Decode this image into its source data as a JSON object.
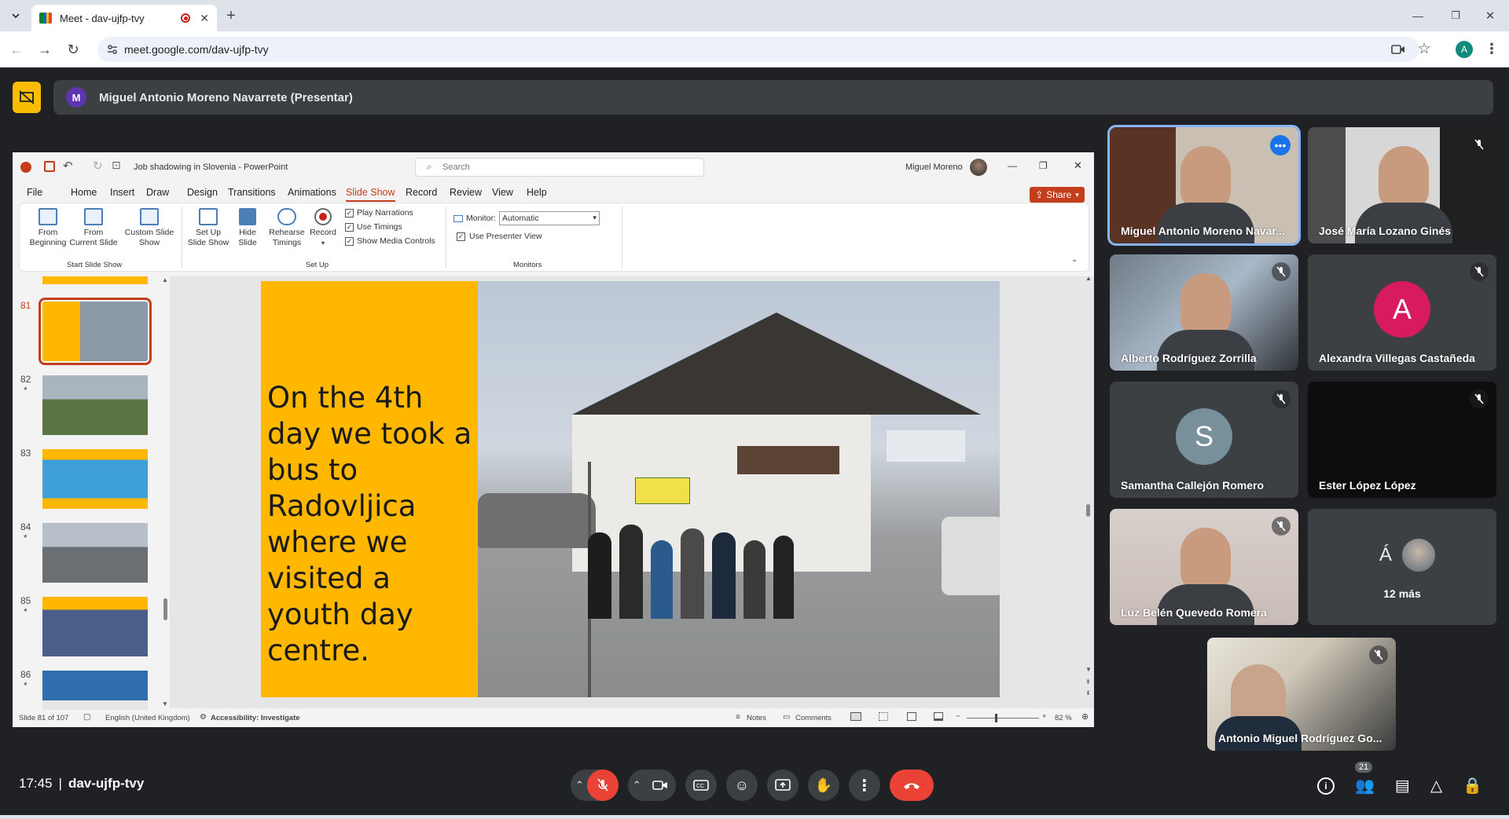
{
  "browser": {
    "tab_title": "Meet - dav-ujfp-tvy",
    "url": "meet.google.com/dav-ujfp-tvy",
    "profile_initial": "A"
  },
  "meet": {
    "presenter_initial": "M",
    "presenter_banner": "Miguel Antonio Moreno Navarrete (Presentar)",
    "time": "17:45",
    "separator": "|",
    "meeting_code": "dav-ujfp-tvy",
    "participant_count": "21",
    "participants": [
      {
        "name": "Miguel Antonio Moreno Navar...",
        "type": "video"
      },
      {
        "name": "José María Lozano Ginés",
        "type": "video"
      },
      {
        "name": "Alberto Rodríguez Zorrilla",
        "type": "video"
      },
      {
        "name": "Alexandra Villegas Castañeda",
        "type": "avatar",
        "initial": "A",
        "color": "#d81b60"
      },
      {
        "name": "Samantha Callejón Romero",
        "type": "avatar",
        "initial": "S",
        "color": "#78909c"
      },
      {
        "name": "Ester López López",
        "type": "video"
      },
      {
        "name": "Luz Belén Quevedo Romera",
        "type": "video"
      },
      {
        "name": "12 más",
        "type": "more",
        "initial": "Á"
      },
      {
        "name": "Antonio Miguel Rodríguez Go...",
        "type": "video"
      }
    ]
  },
  "ppt": {
    "doc_title": "Job shadowing in Slovenia - PowerPoint",
    "search_placeholder": "Search",
    "user": "Miguel Moreno",
    "share_label": "Share",
    "menu": [
      "File",
      "Home",
      "Insert",
      "Draw",
      "Design",
      "Transitions",
      "Animations",
      "Slide Show",
      "Record",
      "Review",
      "View",
      "Help"
    ],
    "active_menu": "Slide Show",
    "ribbon": {
      "from_beginning": "From\nBeginning",
      "from_current": "From\nCurrent Slide",
      "custom_show": "Custom Slide\nShow",
      "group1": "Start Slide Show",
      "setup_show": "Set Up\nSlide Show",
      "hide_slide": "Hide\nSlide",
      "rehearse": "Rehearse\nTimings",
      "record": "Record",
      "play_narrations": "Play Narrations",
      "use_timings": "Use Timings",
      "show_media": "Show Media Controls",
      "group2": "Set Up",
      "monitor_label": "Monitor:",
      "monitor_value": "Automatic",
      "presenter_view": "Use Presenter View",
      "group3": "Monitors"
    },
    "thumbnails": [
      {
        "num": "81",
        "star": "",
        "selected": true
      },
      {
        "num": "82",
        "star": "*",
        "selected": false
      },
      {
        "num": "83",
        "star": "",
        "selected": false
      },
      {
        "num": "84",
        "star": "*",
        "selected": false
      },
      {
        "num": "85",
        "star": "*",
        "selected": false
      },
      {
        "num": "86",
        "star": "*",
        "selected": false
      }
    ],
    "slide_text": "On the 4th day we took a bus to Radovljica where we visited a youth day centre.",
    "status": {
      "slide_of": "Slide 81 of 107",
      "language": "English (United Kingdom)",
      "accessibility": "Accessibility: Investigate",
      "notes": "Notes",
      "comments": "Comments",
      "zoom": "82 %"
    }
  },
  "colors": {
    "accent": "#c43e1c",
    "slide_yellow": "#ffb700",
    "meet_red": "#ea4335"
  }
}
